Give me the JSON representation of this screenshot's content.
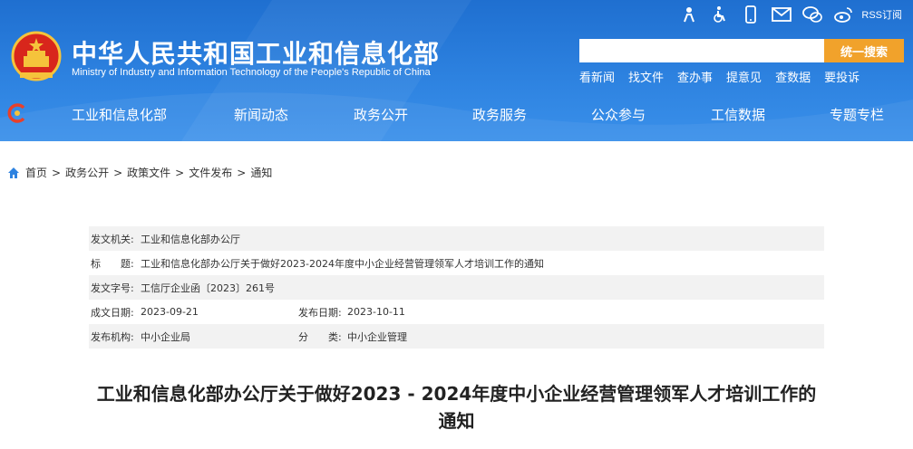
{
  "site": {
    "title": "中华人民共和国工业和信息化部",
    "subtitle": "Ministry of Industry and Information Technology of the People's Republic of China",
    "rss_label": "RSS订阅"
  },
  "search": {
    "placeholder": "",
    "button_label": "统一搜索"
  },
  "quick_links": [
    "看新闻",
    "找文件",
    "查办事",
    "提意见",
    "查数据",
    "要投诉"
  ],
  "nav": [
    "工业和信息化部",
    "新闻动态",
    "政务公开",
    "政务服务",
    "公众参与",
    "工信数据",
    "专题专栏"
  ],
  "breadcrumb": [
    "首页",
    "政务公开",
    "政策文件",
    "文件发布",
    "通知"
  ],
  "meta": {
    "issuer_label": "发文机关:",
    "issuer": "工业和信息化部办公厅",
    "title_label": "标　　题:",
    "title": "工业和信息化部办公厅关于做好2023-2024年度中小企业经营管理领军人才培训工作的通知",
    "doc_no_label": "发文字号:",
    "doc_no": "工信厅企业函〔2023〕261号",
    "created_label": "成文日期:",
    "created": "2023-09-21",
    "published_label": "发布日期:",
    "published": "2023-10-11",
    "org_label": "发布机构:",
    "org": "中小企业局",
    "category_label": "分　　类:",
    "category": "中小企业管理"
  },
  "document": {
    "title": "工业和信息化部办公厅关于做好2023 - 2024年度中小企业经营管理领军人才培训工作的通知"
  },
  "colors": {
    "header_blue": "#2d82e0",
    "search_button": "#f1a22b"
  }
}
